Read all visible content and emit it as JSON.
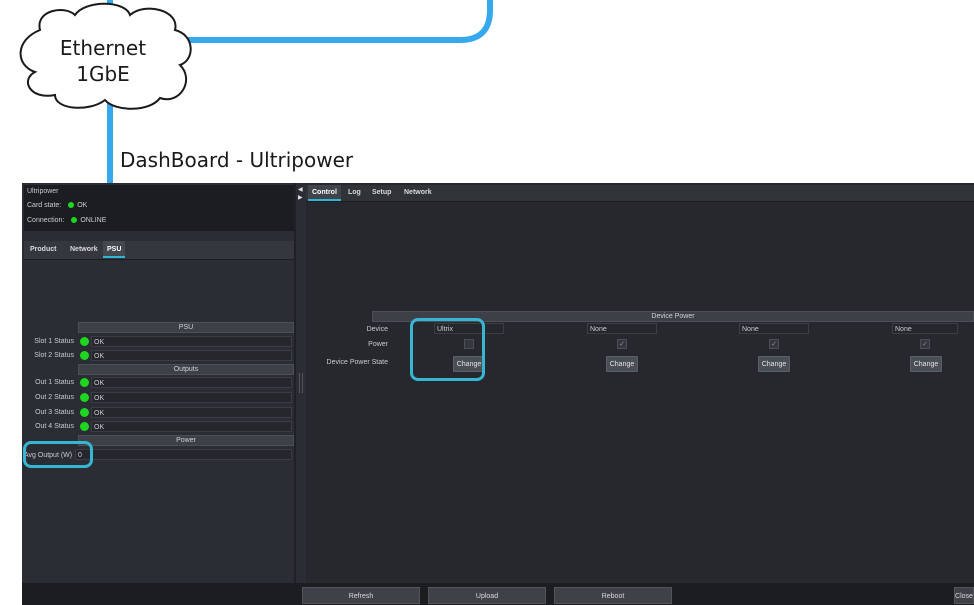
{
  "diagram": {
    "cloud_line1": "Ethernet",
    "cloud_line2": "1GbE",
    "dashboard_title": "DashBoard - Ultripower"
  },
  "header": {
    "device_name": "Ultripower",
    "card_state_label": "Card state:",
    "card_state_value": "OK",
    "connection_label": "Connection:",
    "connection_value": "ONLINE"
  },
  "left_tabs": [
    "Product",
    "Network",
    "PSU"
  ],
  "psu_panel": {
    "psu_header": "PSU",
    "slot1_label": "Slot 1 Status",
    "slot1_value": "OK",
    "slot2_label": "Slot 2 Status",
    "slot2_value": "OK",
    "outputs_header": "Outputs",
    "out1_label": "Out 1 Status",
    "out1_value": "OK",
    "out2_label": "Out 2 Status",
    "out2_value": "OK",
    "out3_label": "Out 3 Status",
    "out3_value": "OK",
    "out4_label": "Out 4 Status",
    "out4_value": "OK",
    "power_header": "Power",
    "avg_output_label": "Avg Output (W)",
    "avg_output_value": "0"
  },
  "right_tabs": [
    "Control",
    "Log",
    "Setup",
    "Network"
  ],
  "device_power": {
    "header": "Device Power",
    "device_label": "Device",
    "power_label": "Power",
    "state_label": "Device Power State",
    "devices": [
      "Ultrix",
      "None",
      "None",
      "None"
    ],
    "power_checked": [
      false,
      true,
      true,
      true
    ],
    "change_label": "Change"
  },
  "footer": {
    "refresh": "Refresh",
    "upload": "Upload",
    "reboot": "Reboot",
    "close": "Close"
  },
  "colors": {
    "accent": "#36b6d2",
    "status_ok": "#1ed620",
    "panel_bg": "#26282d"
  }
}
